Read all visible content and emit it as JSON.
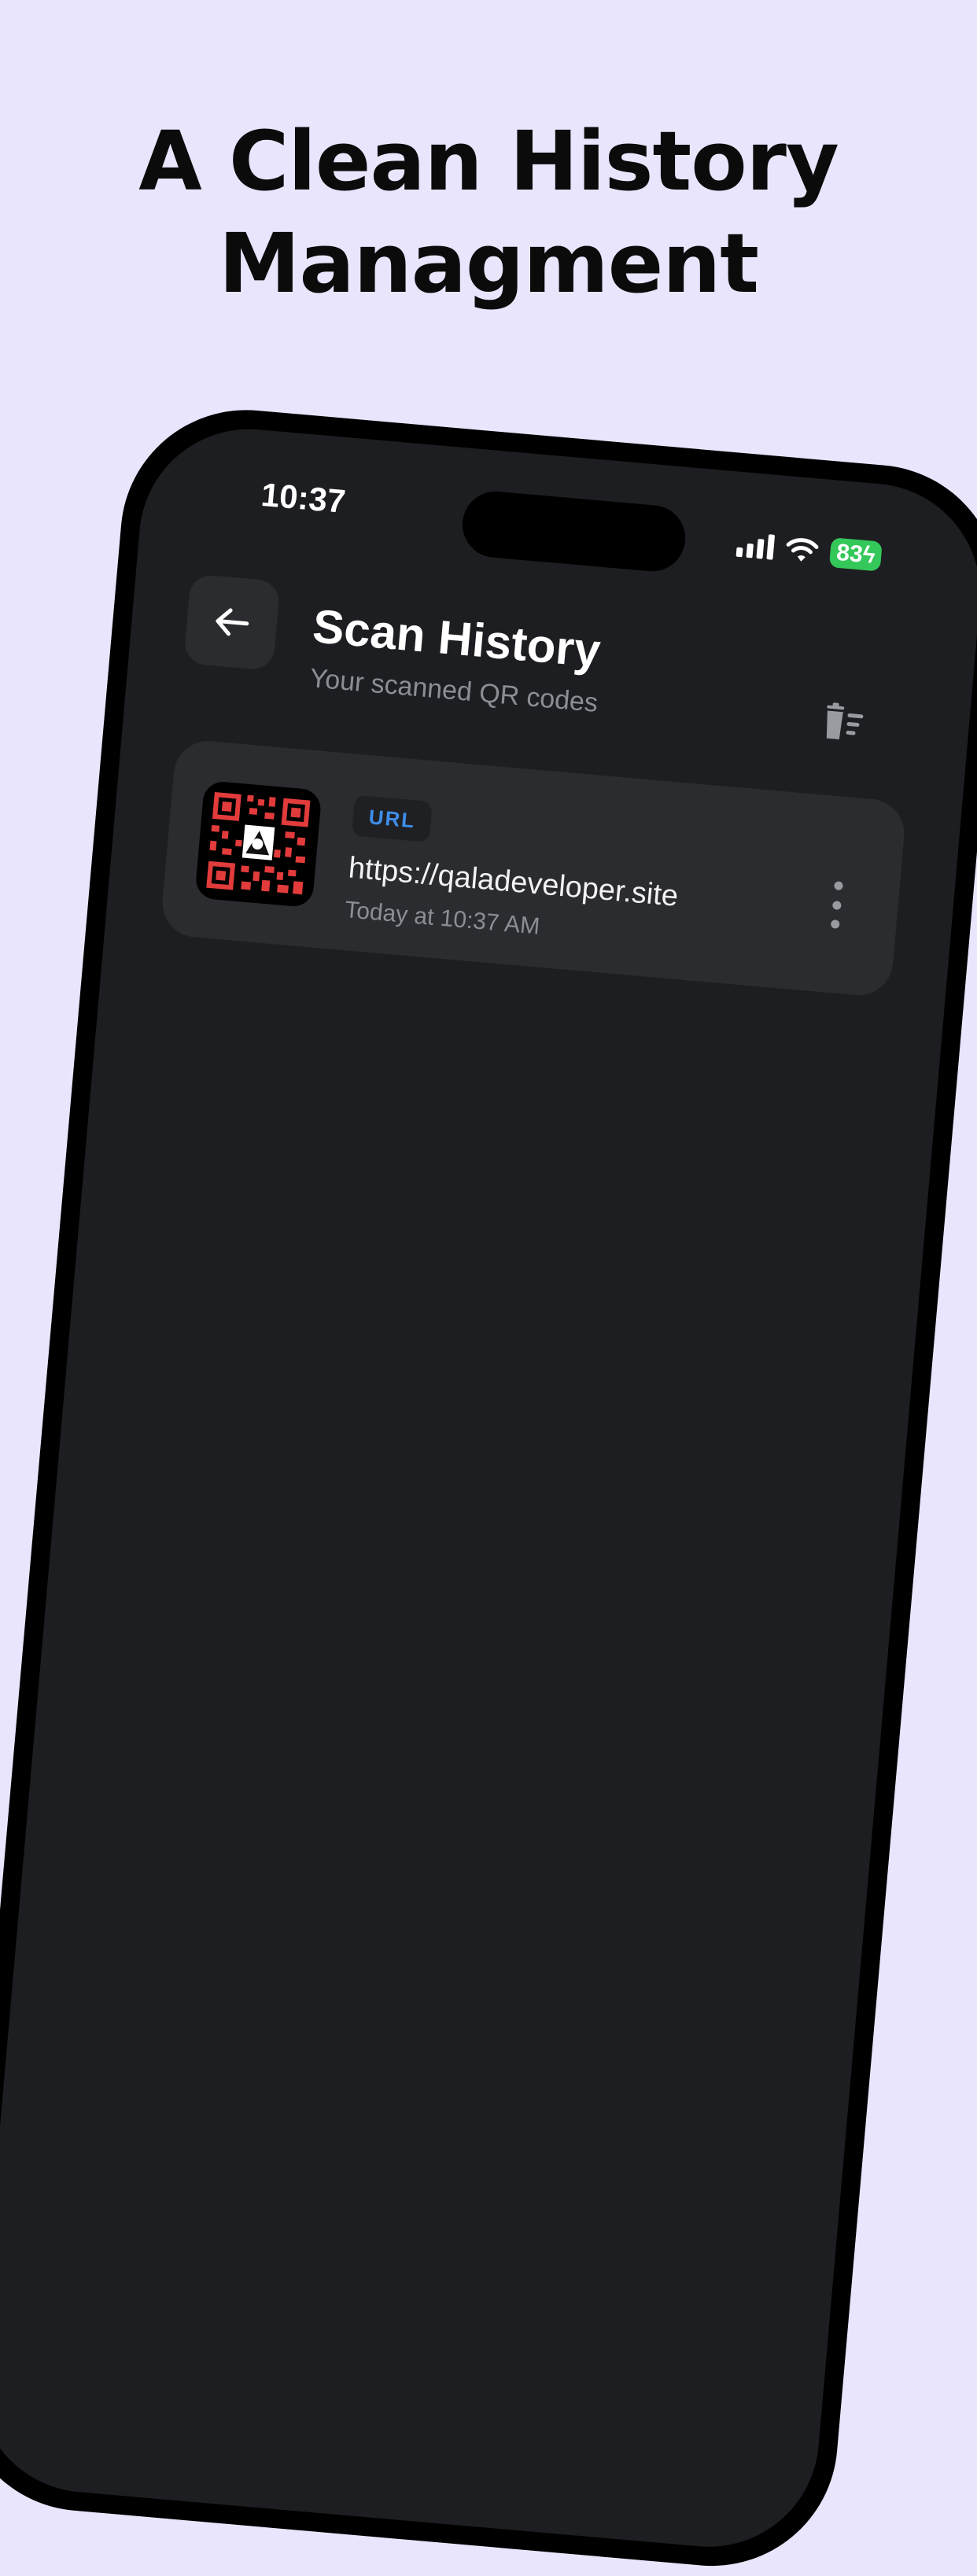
{
  "headline": {
    "line1": "A Clean History",
    "line2": "Managment"
  },
  "status_bar": {
    "time": "10:37",
    "battery": "83"
  },
  "header": {
    "back_icon": "arrow-left-icon",
    "title": "Scan History",
    "subtitle": "Your scanned QR codes",
    "clear_icon": "trash-sweep-icon"
  },
  "history": [
    {
      "type_badge": "URL",
      "content": "https://qaladeveloper.site",
      "timestamp": "Today at 10:37 AM",
      "thumbnail_icon": "qr-code-icon",
      "menu_icon": "more-vertical-icon"
    }
  ],
  "colors": {
    "page_background": "#e9e5fd",
    "screen_background": "#1d1e21",
    "card_background": "#2b2c30",
    "badge_text": "#3e8ee8",
    "qr_color": "#e23b3b",
    "battery": "#34c759"
  }
}
